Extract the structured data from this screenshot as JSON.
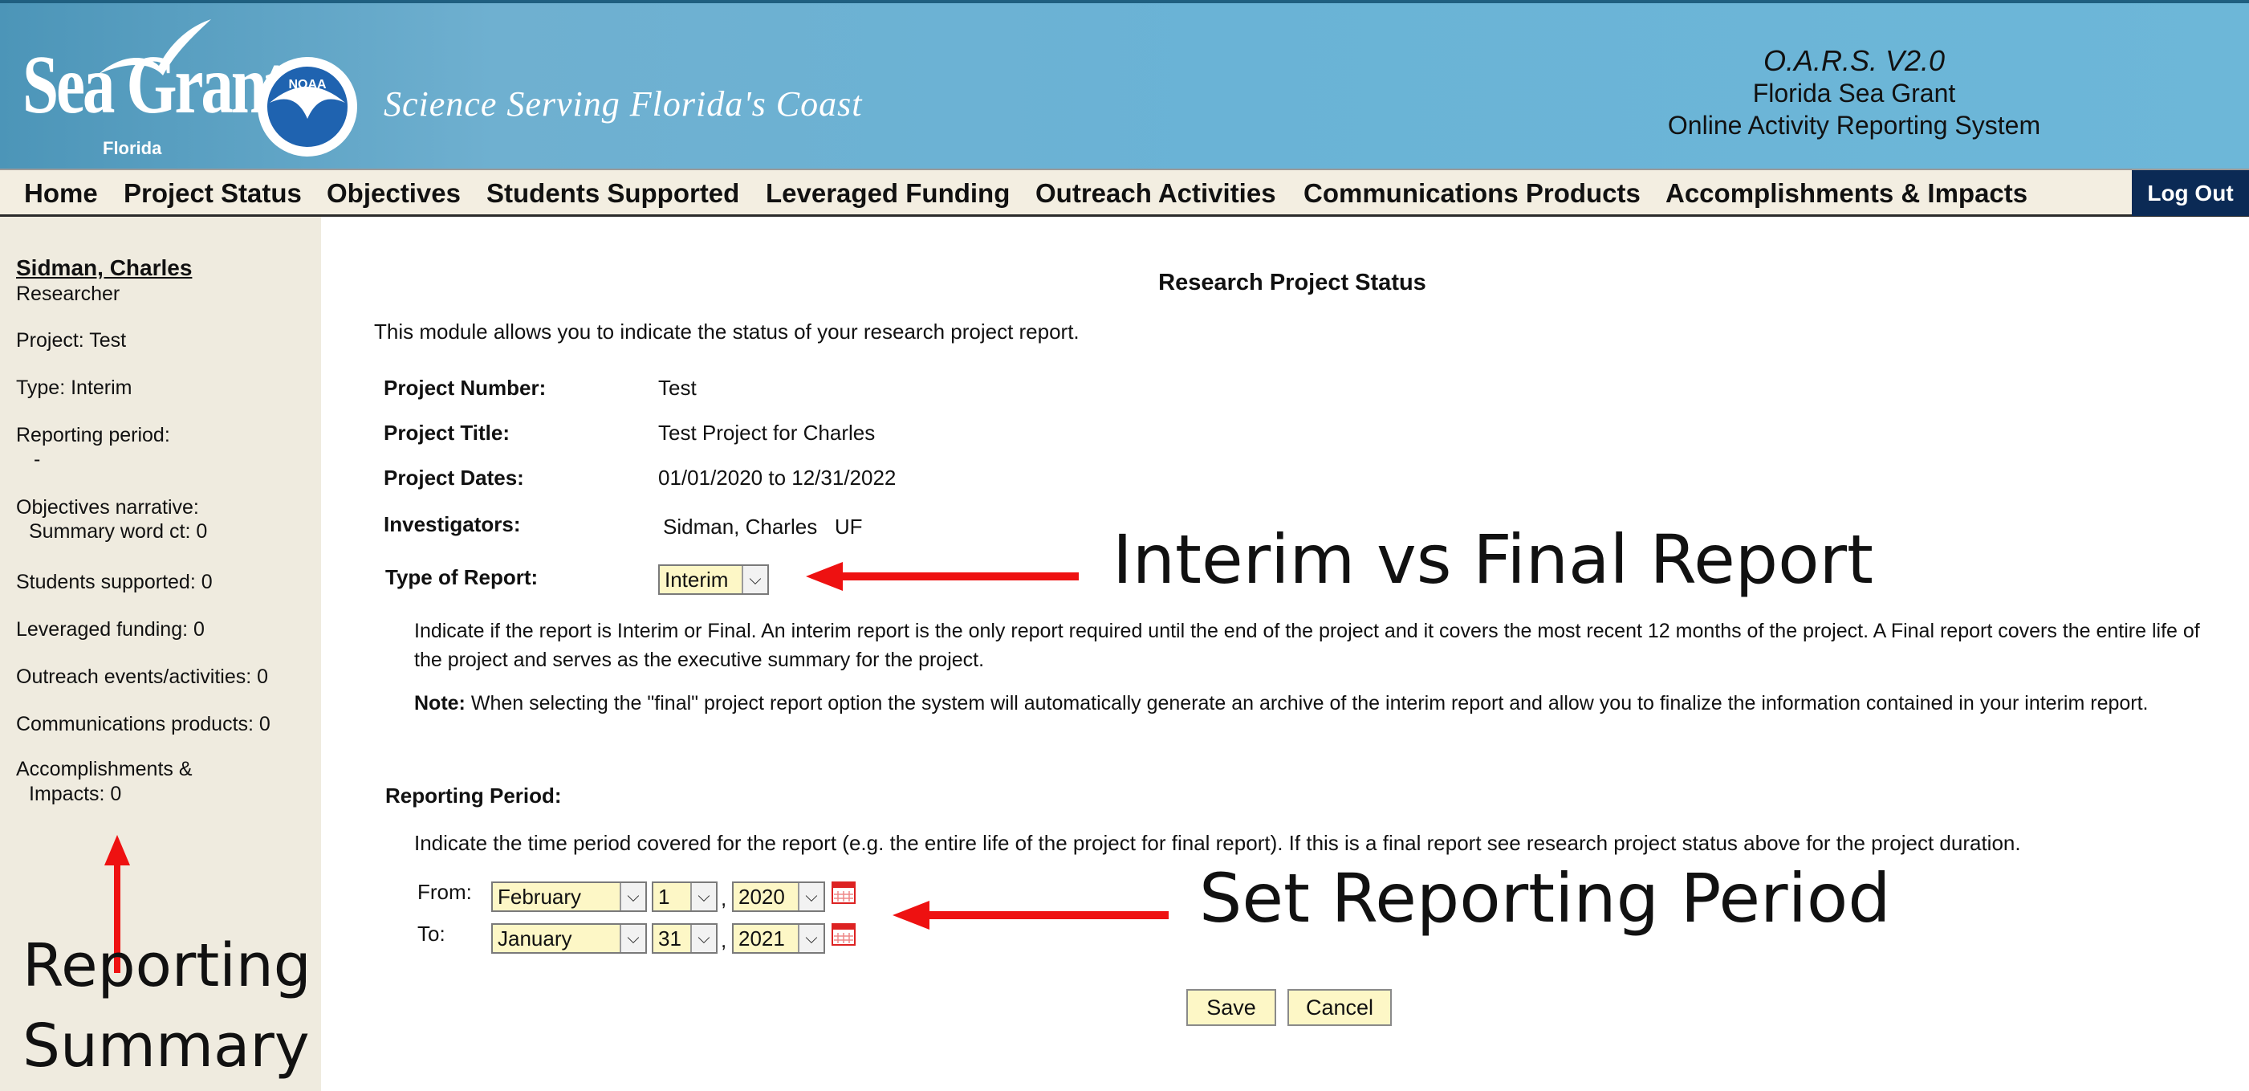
{
  "header": {
    "logo_word": "Sea Grant",
    "logo_sub": "Florida",
    "noaa_label": "NOAA",
    "tagline": "Science Serving Florida's Coast",
    "version": "O.A.R.S. V2.0",
    "org": "Florida Sea Grant",
    "system_name": "Online Activity Reporting System",
    "colors": {
      "banner": "#6ab3d6",
      "logout_bg": "#0b2a55",
      "field_bg": "#fdf7c6"
    }
  },
  "nav": {
    "items": [
      "Home",
      "Project Status",
      "Objectives",
      "Students Supported",
      "Leveraged Funding",
      "Outreach Activities",
      "Communications Products",
      "Accomplishments & Impacts"
    ],
    "logout": "Log Out"
  },
  "sidebar": {
    "user_name": "Sidman, Charles",
    "role": "Researcher",
    "project": "Project: Test",
    "type": "Type: Interim",
    "reporting_period_label": "Reporting period:",
    "reporting_period_value": "-",
    "objectives_line1": "Objectives narrative:",
    "objectives_line2": "Summary word ct: 0",
    "students": "Students supported: 0",
    "leveraged": "Leveraged funding: 0",
    "outreach": "Outreach events/activities: 0",
    "communications": "Communications products: 0",
    "accomplishments_line1": "Accomplishments &",
    "accomplishments_line2": "Impacts: 0"
  },
  "main": {
    "title": "Research Project Status",
    "intro": "This module allows you to indicate the status of your research project report.",
    "project_number_label": "Project Number:",
    "project_number": "Test",
    "project_title_label": "Project Title:",
    "project_title": "Test Project for Charles",
    "project_dates_label": "Project Dates:",
    "project_dates": "01/01/2020 to 12/31/2022",
    "investigators_label": "Investigators:",
    "investigators": "Sidman, Charles   UF",
    "type_label": "Type of Report:",
    "type_value": "Interim",
    "type_help": "Indicate if the report is Interim or Final. An interim report is the only report required until the end of the project and it covers the most recent 12 months of the project. A Final report covers the entire life of the project and serves as the executive summary for the project.",
    "note_label": "Note:",
    "note_text": "When selecting the \"final\" project report option the system will automatically generate an archive of the interim report and allow you to finalize the information contained in your interim report.",
    "period_label": "Reporting Period:",
    "period_help": "Indicate the time period covered for the report (e.g. the entire life of the project for final report). If this is a final report see research project status above for the project duration.",
    "from_label": "From:",
    "from_month": "February",
    "from_day": "1",
    "from_year": "2020",
    "to_label": "To:",
    "to_month": "January",
    "to_day": "31",
    "to_year": "2021",
    "comma": ",",
    "save": "Save",
    "cancel": "Cancel"
  },
  "annotations": {
    "interim_vs_final": "Interim vs Final Report",
    "set_period": "Set Reporting Period",
    "summary_line1": "Reporting",
    "summary_line2": "Summary",
    "arrow_color": "#ee1111"
  }
}
